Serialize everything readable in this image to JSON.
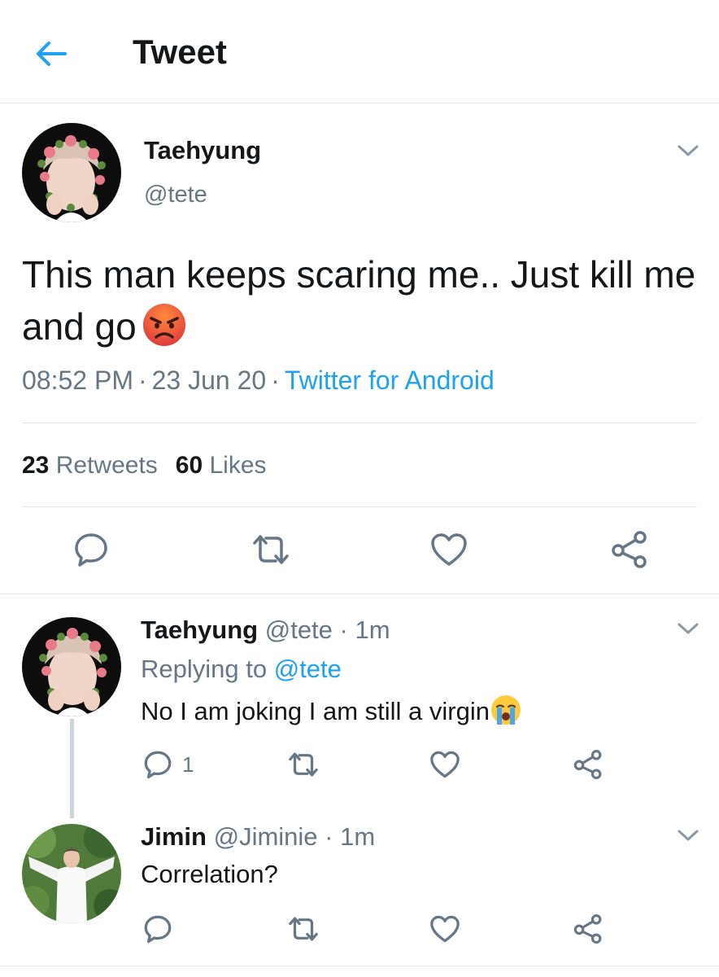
{
  "header": {
    "title": "Tweet",
    "back_icon": "arrow-left-icon"
  },
  "colors": {
    "accent": "#1da1f2",
    "secondary_text": "#657786",
    "divider": "#e1e8ed"
  },
  "tweet": {
    "name": "Taehyung",
    "handle": "@tete",
    "text": "This man keeps scaring me.. Just kill me and go",
    "emoji": "angry-face-emoji",
    "time": "08:52 PM",
    "date": "23 Jun 20",
    "source": "Twitter for Android",
    "retweets_count": "23",
    "retweets_label": "Retweets",
    "likes_count": "60",
    "likes_label": "Likes"
  },
  "replies": [
    {
      "name": "Taehyung",
      "handle": "@tete",
      "time": "1m",
      "replying_label": "Replying to",
      "replying_to": "@tete",
      "text": "No I am joking I am still a virgin",
      "emoji": "loudly-crying-face-emoji",
      "reply_count": "1"
    },
    {
      "name": "Jimin",
      "handle": "@Jiminie",
      "time": "1m",
      "text": "Correlation?"
    }
  ],
  "separator": "·"
}
